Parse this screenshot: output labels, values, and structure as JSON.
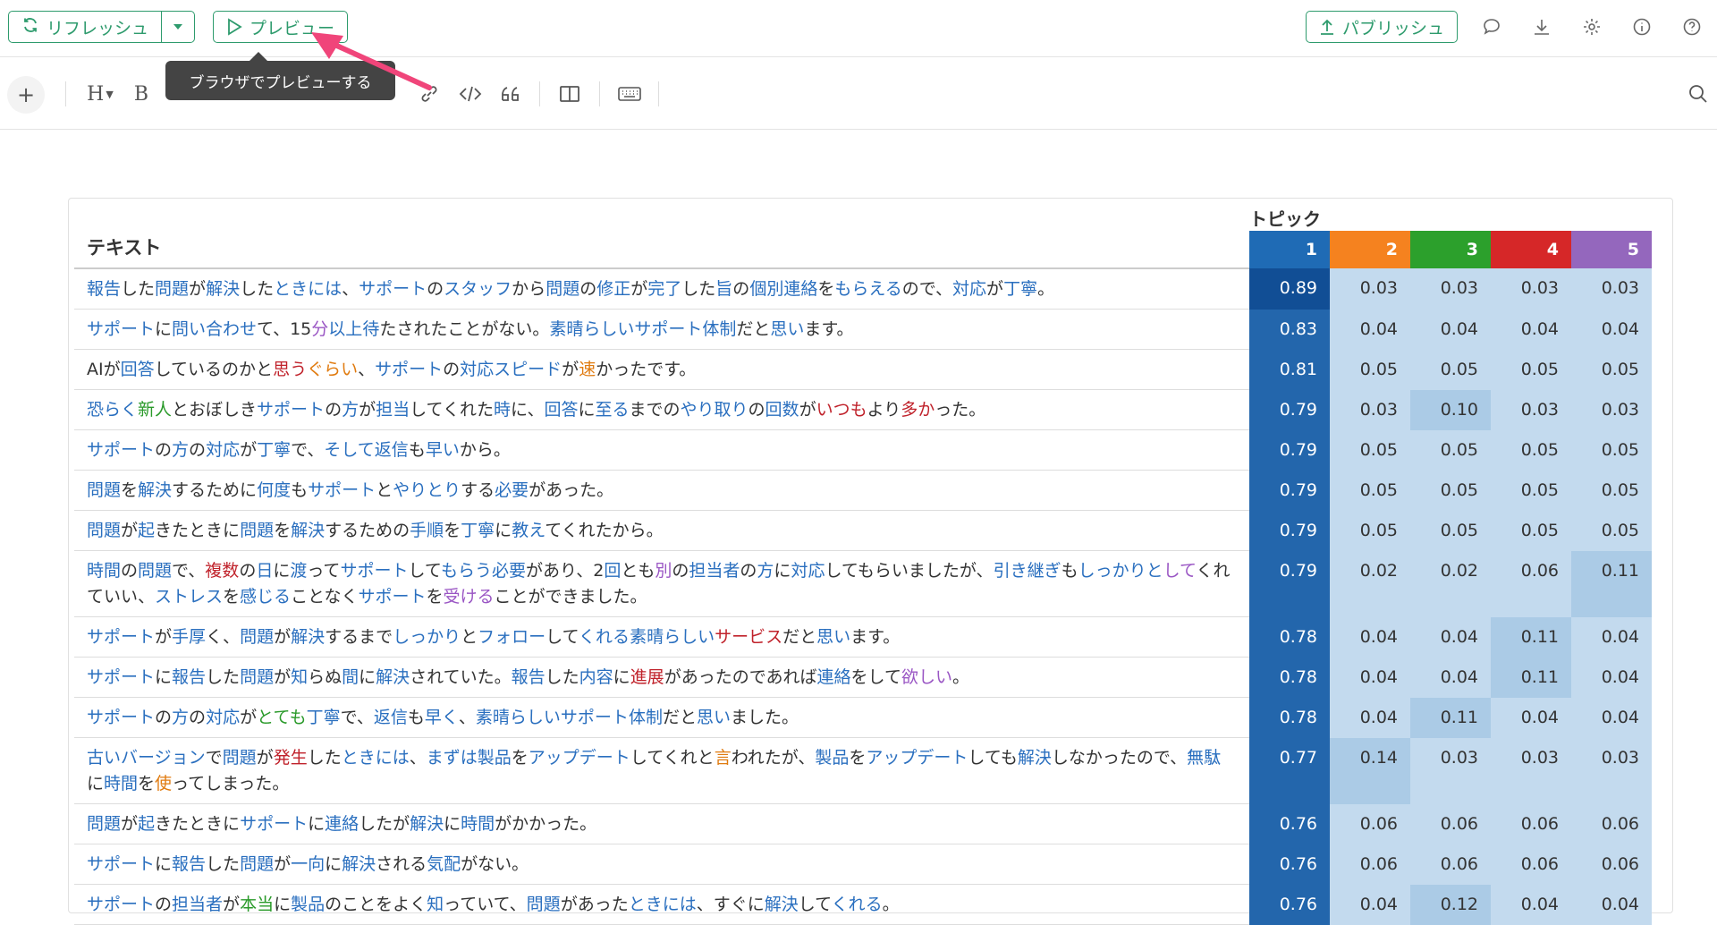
{
  "topbar": {
    "refresh_label": "リフレッシュ",
    "preview_label": "プレビュー",
    "publish_label": "パブリッシュ"
  },
  "tooltip": {
    "text": "ブラウザでプレビューする"
  },
  "toolbar": {
    "plus": "+",
    "heading": "H",
    "bold": "B"
  },
  "table": {
    "topic_header": "トピック",
    "text_header": "テキスト",
    "topics": [
      {
        "label": "1",
        "color": "#1f6bb5"
      },
      {
        "label": "2",
        "color": "#f5821f"
      },
      {
        "label": "3",
        "color": "#2ca02c"
      },
      {
        "label": "4",
        "color": "#d62728"
      },
      {
        "label": "5",
        "color": "#9467bd"
      }
    ],
    "rows": [
      {
        "segments": [
          [
            "報告",
            "b"
          ],
          [
            "した",
            ""
          ],
          [
            "問題",
            "b"
          ],
          [
            "が",
            ""
          ],
          [
            "解決",
            "b"
          ],
          [
            "した",
            ""
          ],
          [
            "ときには",
            "b"
          ],
          [
            "、",
            ""
          ],
          [
            "サポート",
            "b"
          ],
          [
            "の",
            ""
          ],
          [
            "スタッフ",
            "b"
          ],
          [
            "から",
            ""
          ],
          [
            "問題",
            "b"
          ],
          [
            "の",
            ""
          ],
          [
            "修正",
            "b"
          ],
          [
            "が",
            ""
          ],
          [
            "完了",
            "b"
          ],
          [
            "した",
            ""
          ],
          [
            "旨",
            "b"
          ],
          [
            "の",
            ""
          ],
          [
            "個別連絡",
            "b"
          ],
          [
            "を",
            ""
          ],
          [
            "もらえる",
            "b"
          ],
          [
            "ので、",
            ""
          ],
          [
            "対応",
            "b"
          ],
          [
            "が",
            ""
          ],
          [
            "丁寧",
            "b"
          ],
          [
            "。",
            ""
          ]
        ],
        "values": [
          "0.89",
          "0.03",
          "0.03",
          "0.03",
          "0.03"
        ]
      },
      {
        "segments": [
          [
            "サポート",
            "b"
          ],
          [
            "に",
            ""
          ],
          [
            "問い合わせ",
            "b"
          ],
          [
            "て、15",
            ""
          ],
          [
            "分",
            "p"
          ],
          [
            "以上",
            "b"
          ],
          [
            "待",
            "b"
          ],
          [
            "たされたことがない。",
            ""
          ],
          [
            "素晴らしい",
            "b"
          ],
          [
            "サポート",
            "b"
          ],
          [
            "体制",
            "b"
          ],
          [
            "だと",
            ""
          ],
          [
            "思い",
            "b"
          ],
          [
            "ます。",
            ""
          ]
        ],
        "values": [
          "0.83",
          "0.04",
          "0.04",
          "0.04",
          "0.04"
        ]
      },
      {
        "segments": [
          [
            "AIが",
            ""
          ],
          [
            "回答",
            "b"
          ],
          [
            "しているのかと",
            ""
          ],
          [
            "思う",
            "r"
          ],
          [
            "ぐらい",
            "o"
          ],
          [
            "、",
            ""
          ],
          [
            "サポート",
            "b"
          ],
          [
            "の",
            ""
          ],
          [
            "対応",
            "b"
          ],
          [
            "スピード",
            "b"
          ],
          [
            "が",
            ""
          ],
          [
            "速",
            "o"
          ],
          [
            "かったです。",
            ""
          ]
        ],
        "values": [
          "0.81",
          "0.05",
          "0.05",
          "0.05",
          "0.05"
        ]
      },
      {
        "segments": [
          [
            "恐らく",
            "b"
          ],
          [
            "新人",
            "g"
          ],
          [
            "とおぼしき",
            ""
          ],
          [
            "サポート",
            "b"
          ],
          [
            "の",
            ""
          ],
          [
            "方",
            "b"
          ],
          [
            "が",
            ""
          ],
          [
            "担当",
            "b"
          ],
          [
            "してくれた",
            ""
          ],
          [
            "時",
            "b"
          ],
          [
            "に、",
            ""
          ],
          [
            "回答",
            "b"
          ],
          [
            "に",
            ""
          ],
          [
            "至る",
            "b"
          ],
          [
            "までの",
            ""
          ],
          [
            "やり取り",
            "b"
          ],
          [
            "の",
            ""
          ],
          [
            "回数",
            "b"
          ],
          [
            "が",
            ""
          ],
          [
            "いつも",
            "r"
          ],
          [
            "より",
            ""
          ],
          [
            "多か",
            "r"
          ],
          [
            "った。",
            ""
          ]
        ],
        "values": [
          "0.79",
          "0.03",
          "0.10",
          "0.03",
          "0.03"
        ]
      },
      {
        "segments": [
          [
            "サポート",
            "b"
          ],
          [
            "の",
            ""
          ],
          [
            "方",
            "b"
          ],
          [
            "の",
            ""
          ],
          [
            "対応",
            "b"
          ],
          [
            "が",
            ""
          ],
          [
            "丁寧",
            "b"
          ],
          [
            "で、",
            ""
          ],
          [
            "そして",
            "b"
          ],
          [
            "返信",
            "b"
          ],
          [
            "も",
            ""
          ],
          [
            "早い",
            "b"
          ],
          [
            "から。",
            ""
          ]
        ],
        "values": [
          "0.79",
          "0.05",
          "0.05",
          "0.05",
          "0.05"
        ]
      },
      {
        "segments": [
          [
            "問題",
            "b"
          ],
          [
            "を",
            ""
          ],
          [
            "解決",
            "b"
          ],
          [
            "するために",
            ""
          ],
          [
            "何度",
            "b"
          ],
          [
            "も",
            ""
          ],
          [
            "サポート",
            "b"
          ],
          [
            "と",
            ""
          ],
          [
            "やりとり",
            "b"
          ],
          [
            "する",
            ""
          ],
          [
            "必要",
            "b"
          ],
          [
            "があった。",
            ""
          ]
        ],
        "values": [
          "0.79",
          "0.05",
          "0.05",
          "0.05",
          "0.05"
        ]
      },
      {
        "segments": [
          [
            "問題",
            "b"
          ],
          [
            "が",
            ""
          ],
          [
            "起",
            "b"
          ],
          [
            "きたときに",
            ""
          ],
          [
            "問題",
            "b"
          ],
          [
            "を",
            ""
          ],
          [
            "解決",
            "b"
          ],
          [
            "するための",
            ""
          ],
          [
            "手順",
            "b"
          ],
          [
            "を",
            ""
          ],
          [
            "丁寧",
            "b"
          ],
          [
            "に",
            ""
          ],
          [
            "教え",
            "b"
          ],
          [
            "てくれたから。",
            ""
          ]
        ],
        "values": [
          "0.79",
          "0.05",
          "0.05",
          "0.05",
          "0.05"
        ]
      },
      {
        "segments": [
          [
            "時間",
            "b"
          ],
          [
            "の",
            ""
          ],
          [
            "問題",
            "b"
          ],
          [
            "で、",
            ""
          ],
          [
            "複数",
            "r"
          ],
          [
            "の",
            ""
          ],
          [
            "日",
            "b"
          ],
          [
            "に",
            ""
          ],
          [
            "渡",
            "b"
          ],
          [
            "って",
            ""
          ],
          [
            "サポート",
            "b"
          ],
          [
            "して",
            ""
          ],
          [
            "もらう",
            "b"
          ],
          [
            "必要",
            "b"
          ],
          [
            "があり、2",
            ""
          ],
          [
            "回",
            "b"
          ],
          [
            "とも",
            ""
          ],
          [
            "別",
            "p"
          ],
          [
            "の",
            ""
          ],
          [
            "担当者",
            "b"
          ],
          [
            "の",
            ""
          ],
          [
            "方",
            "b"
          ],
          [
            "に",
            ""
          ],
          [
            "対応",
            "b"
          ],
          [
            "してもらいましたが、",
            ""
          ],
          [
            "引き継ぎ",
            "b"
          ],
          [
            "も",
            ""
          ],
          [
            "しっかりと",
            "b"
          ],
          [
            "して",
            "p"
          ],
          [
            "くれていい、",
            ""
          ],
          [
            "ストレス",
            "b"
          ],
          [
            "を",
            ""
          ],
          [
            "感じる",
            "b"
          ],
          [
            "ことなく",
            ""
          ],
          [
            "サポート",
            "b"
          ],
          [
            "を",
            ""
          ],
          [
            "受ける",
            "p"
          ],
          [
            "ことができました。",
            ""
          ]
        ],
        "values": [
          "0.79",
          "0.02",
          "0.02",
          "0.06",
          "0.11"
        ]
      },
      {
        "segments": [
          [
            "サポート",
            "b"
          ],
          [
            "が",
            ""
          ],
          [
            "手厚",
            "b"
          ],
          [
            "く、",
            ""
          ],
          [
            "問題",
            "b"
          ],
          [
            "が",
            ""
          ],
          [
            "解決",
            "b"
          ],
          [
            "するまで",
            ""
          ],
          [
            "しっかり",
            "b"
          ],
          [
            "と",
            ""
          ],
          [
            "フォロー",
            "b"
          ],
          [
            "して",
            ""
          ],
          [
            "くれる",
            "b"
          ],
          [
            "素晴らしい",
            "b"
          ],
          [
            "サービス",
            "r"
          ],
          [
            "だと",
            ""
          ],
          [
            "思い",
            "b"
          ],
          [
            "ます。",
            ""
          ]
        ],
        "values": [
          "0.78",
          "0.04",
          "0.04",
          "0.11",
          "0.04"
        ]
      },
      {
        "segments": [
          [
            "サポート",
            "b"
          ],
          [
            "に",
            ""
          ],
          [
            "報告",
            "b"
          ],
          [
            "した",
            ""
          ],
          [
            "問題",
            "b"
          ],
          [
            "が",
            ""
          ],
          [
            "知",
            "b"
          ],
          [
            "らぬ",
            ""
          ],
          [
            "間",
            "b"
          ],
          [
            "に",
            ""
          ],
          [
            "解決",
            "b"
          ],
          [
            "されていた。",
            ""
          ],
          [
            "報告",
            "b"
          ],
          [
            "した",
            ""
          ],
          [
            "内容",
            "b"
          ],
          [
            "に",
            ""
          ],
          [
            "進展",
            "r"
          ],
          [
            "があったのであれば",
            ""
          ],
          [
            "連絡",
            "b"
          ],
          [
            "をして",
            ""
          ],
          [
            "欲しい",
            "p"
          ],
          [
            "。",
            ""
          ]
        ],
        "values": [
          "0.78",
          "0.04",
          "0.04",
          "0.11",
          "0.04"
        ]
      },
      {
        "segments": [
          [
            "サポート",
            "b"
          ],
          [
            "の",
            ""
          ],
          [
            "方",
            "b"
          ],
          [
            "の",
            ""
          ],
          [
            "対応",
            "b"
          ],
          [
            "が",
            ""
          ],
          [
            "とても",
            "g"
          ],
          [
            "丁寧",
            "b"
          ],
          [
            "で、",
            ""
          ],
          [
            "返信",
            "b"
          ],
          [
            "も",
            ""
          ],
          [
            "早く",
            "b"
          ],
          [
            "、",
            ""
          ],
          [
            "素晴らしい",
            "b"
          ],
          [
            "サポート",
            "b"
          ],
          [
            "体制",
            "b"
          ],
          [
            "だと",
            ""
          ],
          [
            "思い",
            "b"
          ],
          [
            "ました。",
            ""
          ]
        ],
        "values": [
          "0.78",
          "0.04",
          "0.11",
          "0.04",
          "0.04"
        ]
      },
      {
        "segments": [
          [
            "古い",
            "b"
          ],
          [
            "バージョン",
            "b"
          ],
          [
            "で",
            ""
          ],
          [
            "問題",
            "b"
          ],
          [
            "が",
            ""
          ],
          [
            "発生",
            "r"
          ],
          [
            "した",
            ""
          ],
          [
            "ときには",
            "b"
          ],
          [
            "、",
            ""
          ],
          [
            "まずは",
            "b"
          ],
          [
            "製品",
            "b"
          ],
          [
            "を",
            ""
          ],
          [
            "アップデート",
            "b"
          ],
          [
            "してくれと",
            ""
          ],
          [
            "言",
            "o"
          ],
          [
            "われたが、",
            ""
          ],
          [
            "製品",
            "b"
          ],
          [
            "を",
            ""
          ],
          [
            "アップデート",
            "b"
          ],
          [
            "しても",
            ""
          ],
          [
            "解決",
            "b"
          ],
          [
            "しなかったので、",
            ""
          ],
          [
            "無駄",
            "b"
          ],
          [
            "に",
            ""
          ],
          [
            "時間",
            "b"
          ],
          [
            "を",
            ""
          ],
          [
            "使",
            "o"
          ],
          [
            "ってしまった。",
            ""
          ]
        ],
        "values": [
          "0.77",
          "0.14",
          "0.03",
          "0.03",
          "0.03"
        ]
      },
      {
        "segments": [
          [
            "問題",
            "b"
          ],
          [
            "が",
            ""
          ],
          [
            "起",
            "b"
          ],
          [
            "きたときに",
            ""
          ],
          [
            "サポート",
            "b"
          ],
          [
            "に",
            ""
          ],
          [
            "連絡",
            "b"
          ],
          [
            "したが",
            ""
          ],
          [
            "解決",
            "b"
          ],
          [
            "に",
            ""
          ],
          [
            "時間",
            "b"
          ],
          [
            "がかかった。",
            ""
          ]
        ],
        "values": [
          "0.76",
          "0.06",
          "0.06",
          "0.06",
          "0.06"
        ]
      },
      {
        "segments": [
          [
            "サポート",
            "b"
          ],
          [
            "に",
            ""
          ],
          [
            "報告",
            "b"
          ],
          [
            "した",
            ""
          ],
          [
            "問題",
            "b"
          ],
          [
            "が",
            ""
          ],
          [
            "一向",
            "b"
          ],
          [
            "に",
            ""
          ],
          [
            "解決",
            "b"
          ],
          [
            "される",
            ""
          ],
          [
            "気配",
            "b"
          ],
          [
            "がない。",
            ""
          ]
        ],
        "values": [
          "0.76",
          "0.06",
          "0.06",
          "0.06",
          "0.06"
        ]
      },
      {
        "segments": [
          [
            "サポート",
            "b"
          ],
          [
            "の",
            ""
          ],
          [
            "担当者",
            "b"
          ],
          [
            "が",
            ""
          ],
          [
            "本当",
            "g"
          ],
          [
            "に",
            ""
          ],
          [
            "製品",
            "b"
          ],
          [
            "のことをよく",
            ""
          ],
          [
            "知",
            "b"
          ],
          [
            "っていて、",
            ""
          ],
          [
            "問題",
            "b"
          ],
          [
            "があった",
            ""
          ],
          [
            "ときには",
            "b"
          ],
          [
            "、すぐに",
            ""
          ],
          [
            "解決",
            "b"
          ],
          [
            "して",
            ""
          ],
          [
            "くれる",
            "b"
          ],
          [
            "。",
            ""
          ]
        ],
        "values": [
          "0.76",
          "0.04",
          "0.12",
          "0.04",
          "0.04"
        ]
      }
    ]
  }
}
